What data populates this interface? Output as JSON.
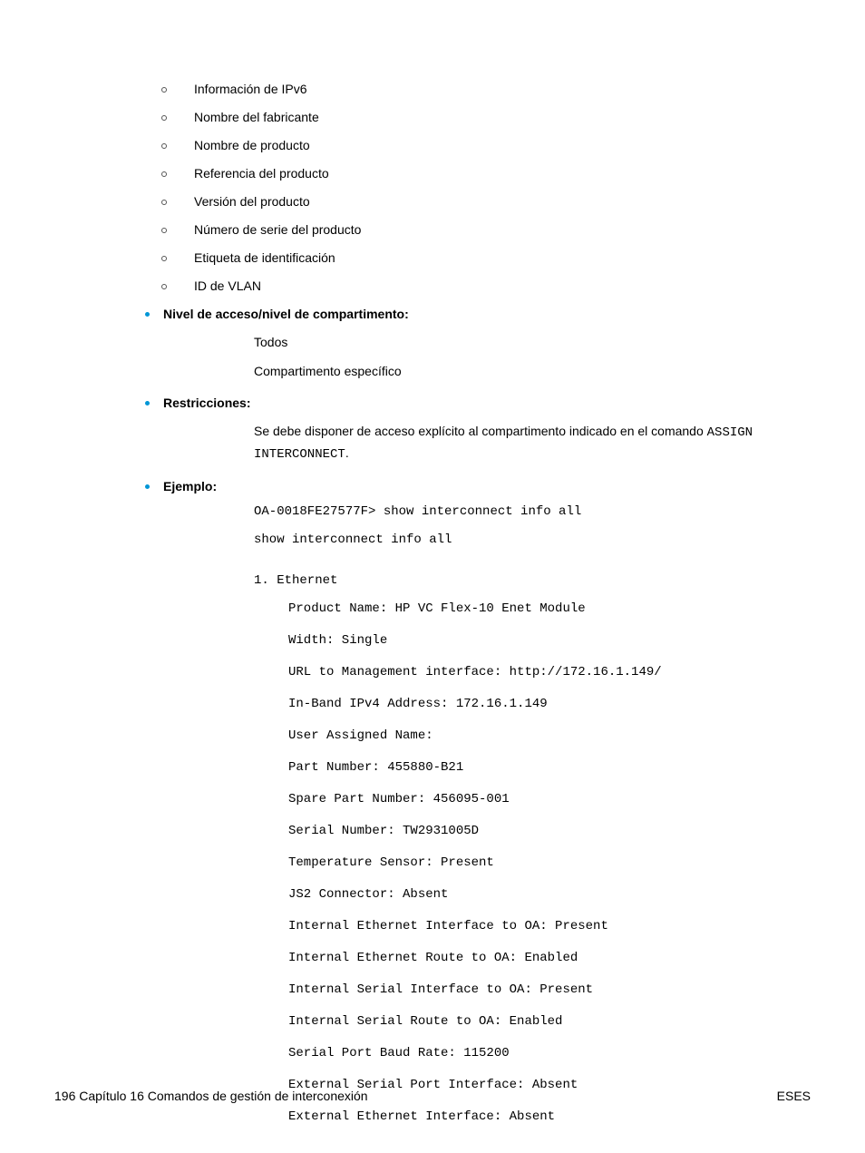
{
  "subItems": [
    "Información de IPv6",
    "Nombre del fabricante",
    "Nombre de producto",
    "Referencia del producto",
    "Versión del producto",
    "Número de serie del producto",
    "Etiqueta de identificación",
    "ID de VLAN"
  ],
  "sections": {
    "access": {
      "title": "Nivel de acceso/nivel de compartimento:",
      "line1": "Todos",
      "line2": "Compartimento específico"
    },
    "restrictions": {
      "title": "Restricciones:",
      "textBefore": "Se debe disponer de acceso explícito al compartimento indicado en el comando ",
      "code": "ASSIGN INTERCONNECT",
      "textAfter": "."
    },
    "example": {
      "title": "Ejemplo:",
      "cmd1": "OA-0018FE27577F> show interconnect info all",
      "cmd2": "show interconnect info all",
      "header": "1. Ethernet",
      "details": [
        "Product Name: HP VC Flex-10 Enet Module",
        "Width: Single",
        "URL to Management interface: http://172.16.1.149/",
        "In-Band IPv4 Address: 172.16.1.149",
        "User Assigned Name:",
        "Part Number: 455880-B21",
        "Spare Part Number: 456095-001",
        "Serial Number: TW2931005D",
        "Temperature Sensor: Present",
        "JS2 Connector: Absent",
        "Internal Ethernet Interface to OA: Present",
        "Internal Ethernet Route to OA: Enabled",
        "Internal Serial Interface to OA: Present",
        "Internal Serial Route to OA: Enabled",
        "Serial Port Baud Rate: 115200",
        "External Serial Port Interface: Absent",
        "External Ethernet Interface: Absent"
      ]
    }
  },
  "footer": {
    "left": "196  Capítulo 16   Comandos de gestión de interconexión",
    "right": "ESES"
  }
}
